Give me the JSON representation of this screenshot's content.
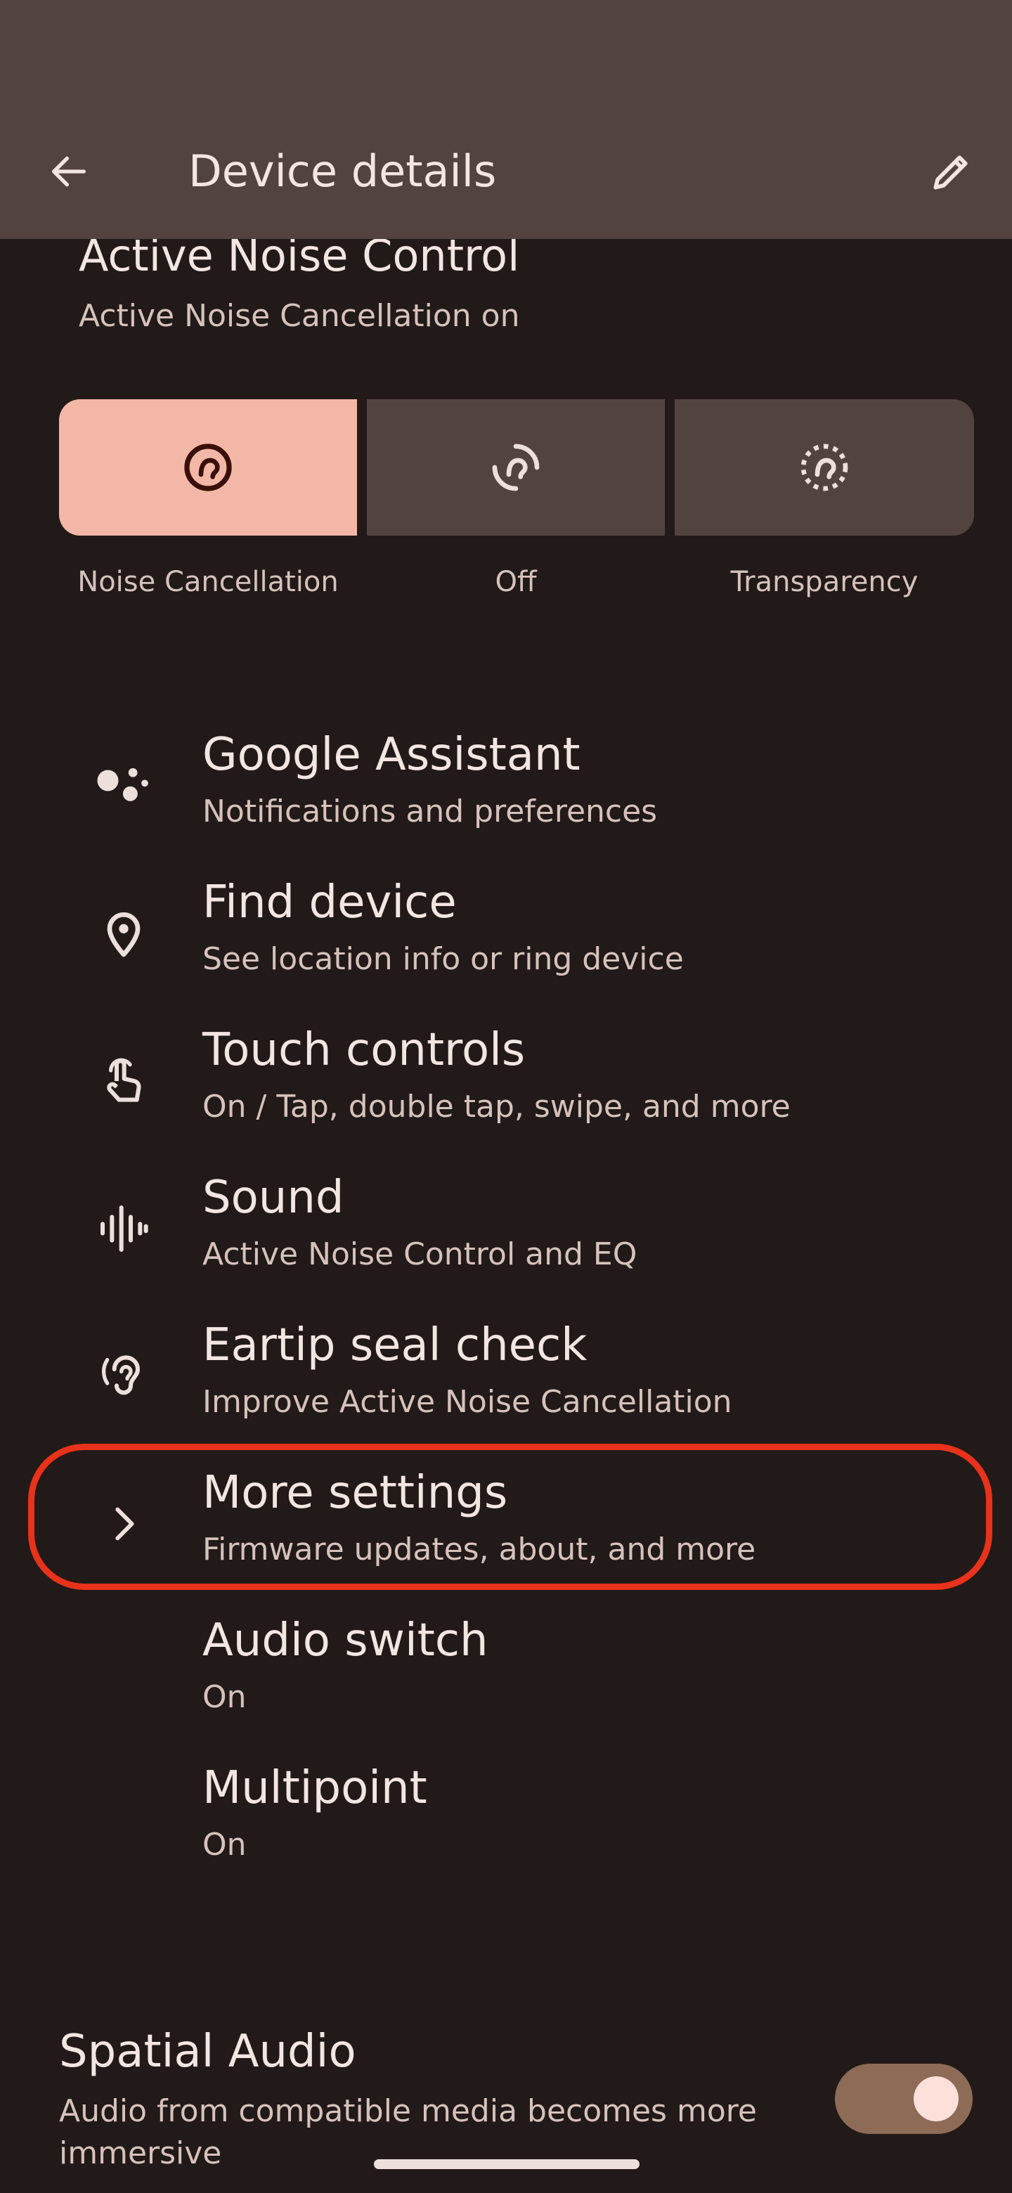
{
  "header": {
    "title": "Device details"
  },
  "anc": {
    "title": "Active Noise Control",
    "subtitle": "Active Noise Cancellation on",
    "options": [
      {
        "label": "Noise Cancellation",
        "icon": "noise-cancellation-icon",
        "selected": true
      },
      {
        "label": "Off",
        "icon": "anc-off-icon",
        "selected": false
      },
      {
        "label": "Transparency",
        "icon": "transparency-icon",
        "selected": false
      }
    ]
  },
  "settings": [
    {
      "title": "Google Assistant",
      "subtitle": "Notifications and preferences",
      "icon": "google-assistant-icon"
    },
    {
      "title": "Find device",
      "subtitle": "See location info or ring device",
      "icon": "location-pin-icon"
    },
    {
      "title": "Touch controls",
      "subtitle": "On / Tap, double tap, swipe, and more",
      "icon": "touch-icon"
    },
    {
      "title": "Sound",
      "subtitle": "Active Noise Control and EQ",
      "icon": "sound-wave-icon"
    },
    {
      "title": "Eartip seal check",
      "subtitle": "Improve Active Noise Cancellation",
      "icon": "ear-icon"
    },
    {
      "title": "More settings",
      "subtitle": "Firmware updates, about, and more",
      "icon": "chevron-right-icon"
    },
    {
      "title": "Audio switch",
      "subtitle": "On"
    },
    {
      "title": "Multipoint",
      "subtitle": "On"
    }
  ],
  "spatial_audio": {
    "title": "Spatial Audio",
    "subtitle": "Audio from compatible media becomes more immersive",
    "enabled": true
  },
  "colors": {
    "background": "#221a18",
    "topbar": "#524341",
    "selected_segment": "#f2b7a6",
    "highlight": "#e8321b",
    "toggle_track": "#8d6b57"
  }
}
